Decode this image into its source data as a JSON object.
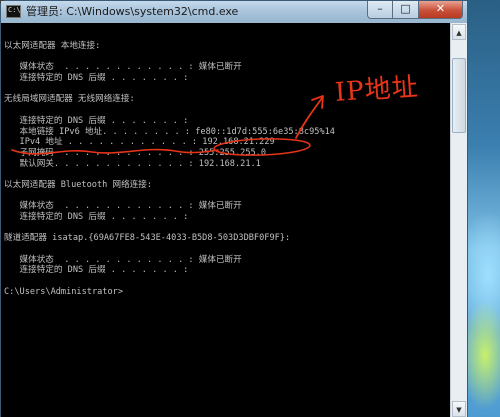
{
  "window": {
    "title": "管理员: C:\\Windows\\system32\\cmd.exe",
    "icon_glyph": "C:\\",
    "buttons": {
      "minimize": "–",
      "maximize": "□",
      "close": "✕"
    }
  },
  "console": {
    "lines": [
      "以太网适配器 本地连接:",
      "",
      "   媒体状态  . . . . . . . . . . . . : 媒体已断开",
      "   连接特定的 DNS 后缀 . . . . . . . :",
      "",
      "无线局域网适配器 无线网络连接:",
      "",
      "   连接特定的 DNS 后缀 . . . . . . . :",
      "   本地链接 IPv6 地址. . . . . . . . : fe80::1d7d:555:6e35:8c95%14",
      "   IPv4 地址 . . . . . . . . . . . . : 192.168.21.229",
      "   子网掩码  . . . . . . . . . . . . : 255.255.255.0",
      "   默认网关. . . . . . . . . . . . . : 192.168.21.1",
      "",
      "以太网适配器 Bluetooth 网络连接:",
      "",
      "   媒体状态  . . . . . . . . . . . . : 媒体已断开",
      "   连接特定的 DNS 后缀 . . . . . . . :",
      "",
      "隧道适配器 isatap.{69A67FE8-543E-4033-B5D8-503D3DBF0F9F}:",
      "",
      "   媒体状态  . . . . . . . . . . . . : 媒体已断开",
      "   连接特定的 DNS 后缀 . . . . . . . :",
      "",
      "C:\\Users\\Administrator>"
    ]
  },
  "scrollbar": {
    "up_arrow": "▲",
    "down_arrow": "▼"
  },
  "annotation": {
    "handwritten_text": "IP地址",
    "color": "#e83418"
  },
  "colors": {
    "console_background": "#000000",
    "console_text": "#c0c0c0",
    "annotation_red": "#e83418"
  }
}
